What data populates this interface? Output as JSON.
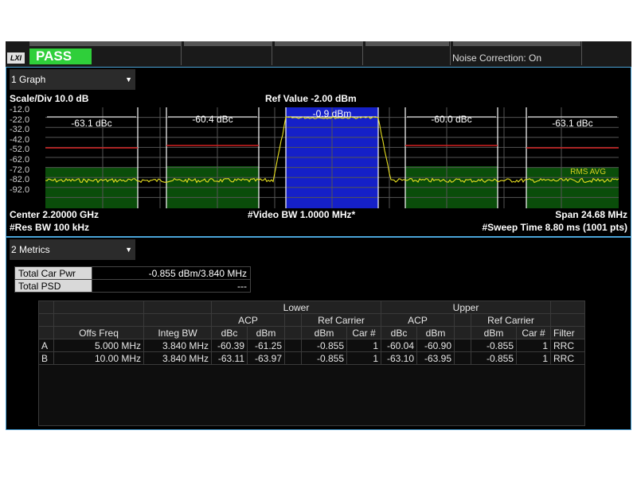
{
  "status": {
    "lxi_label": "LXI",
    "pass_label": "PASS",
    "noise_correction": "Noise Correction: On",
    "colors": {
      "pass": "#2fcf3a",
      "border": "#4aa3d8"
    }
  },
  "graph": {
    "window_label": "1 Graph",
    "scale_div": "Scale/Div 10.0 dB",
    "ref_value": "Ref Value -2.00 dBm",
    "y_ticks": [
      "-12.0",
      "-22.0",
      "-32.0",
      "-42.0",
      "-52.0",
      "-62.0",
      "-72.0",
      "-82.0",
      "-92.0"
    ],
    "band_labels": [
      "-63.1 dBc",
      "-60.4 dBc",
      "-0.9 dBm",
      "-60.0 dBc",
      "-63.1 dBc"
    ],
    "rms_avg": "RMS AVG",
    "center": "Center 2.20000 GHz",
    "video_bw": "#Video BW 1.0000 MHz*",
    "span": "Span 24.68 MHz",
    "res_bw": "#Res BW 100 kHz",
    "sweep_time": "#Sweep Time 8.80 ms (1001 pts)",
    "colors": {
      "carrier": "#1520c8",
      "adjacent": "#0a4d0a",
      "trace": "#e8e020",
      "limit": "#d42020"
    }
  },
  "metrics": {
    "window_label": "2 Metrics",
    "summary": [
      {
        "label": "Total Car Pwr",
        "value": "-0.855 dBm/3.840 MHz"
      },
      {
        "label": "Total PSD",
        "value": "---"
      }
    ],
    "table": {
      "group_lower": "Lower",
      "group_upper": "Upper",
      "acp": "ACP",
      "ref_carrier": "Ref Carrier",
      "columns": [
        "Offs Freq",
        "Integ BW",
        "dBc",
        "dBm",
        "dBm",
        "Car #",
        "dBc",
        "dBm",
        "dBm",
        "Car #",
        "Filter"
      ],
      "rows": [
        [
          "A",
          "5.000 MHz",
          "3.840 MHz",
          "-60.39",
          "-61.25",
          "-0.855",
          "1",
          "-60.04",
          "-60.90",
          "-0.855",
          "1",
          "RRC"
        ],
        [
          "B",
          "10.00 MHz",
          "3.840 MHz",
          "-63.11",
          "-63.97",
          "-0.855",
          "1",
          "-63.10",
          "-63.95",
          "-0.855",
          "1",
          "RRC"
        ]
      ]
    }
  }
}
